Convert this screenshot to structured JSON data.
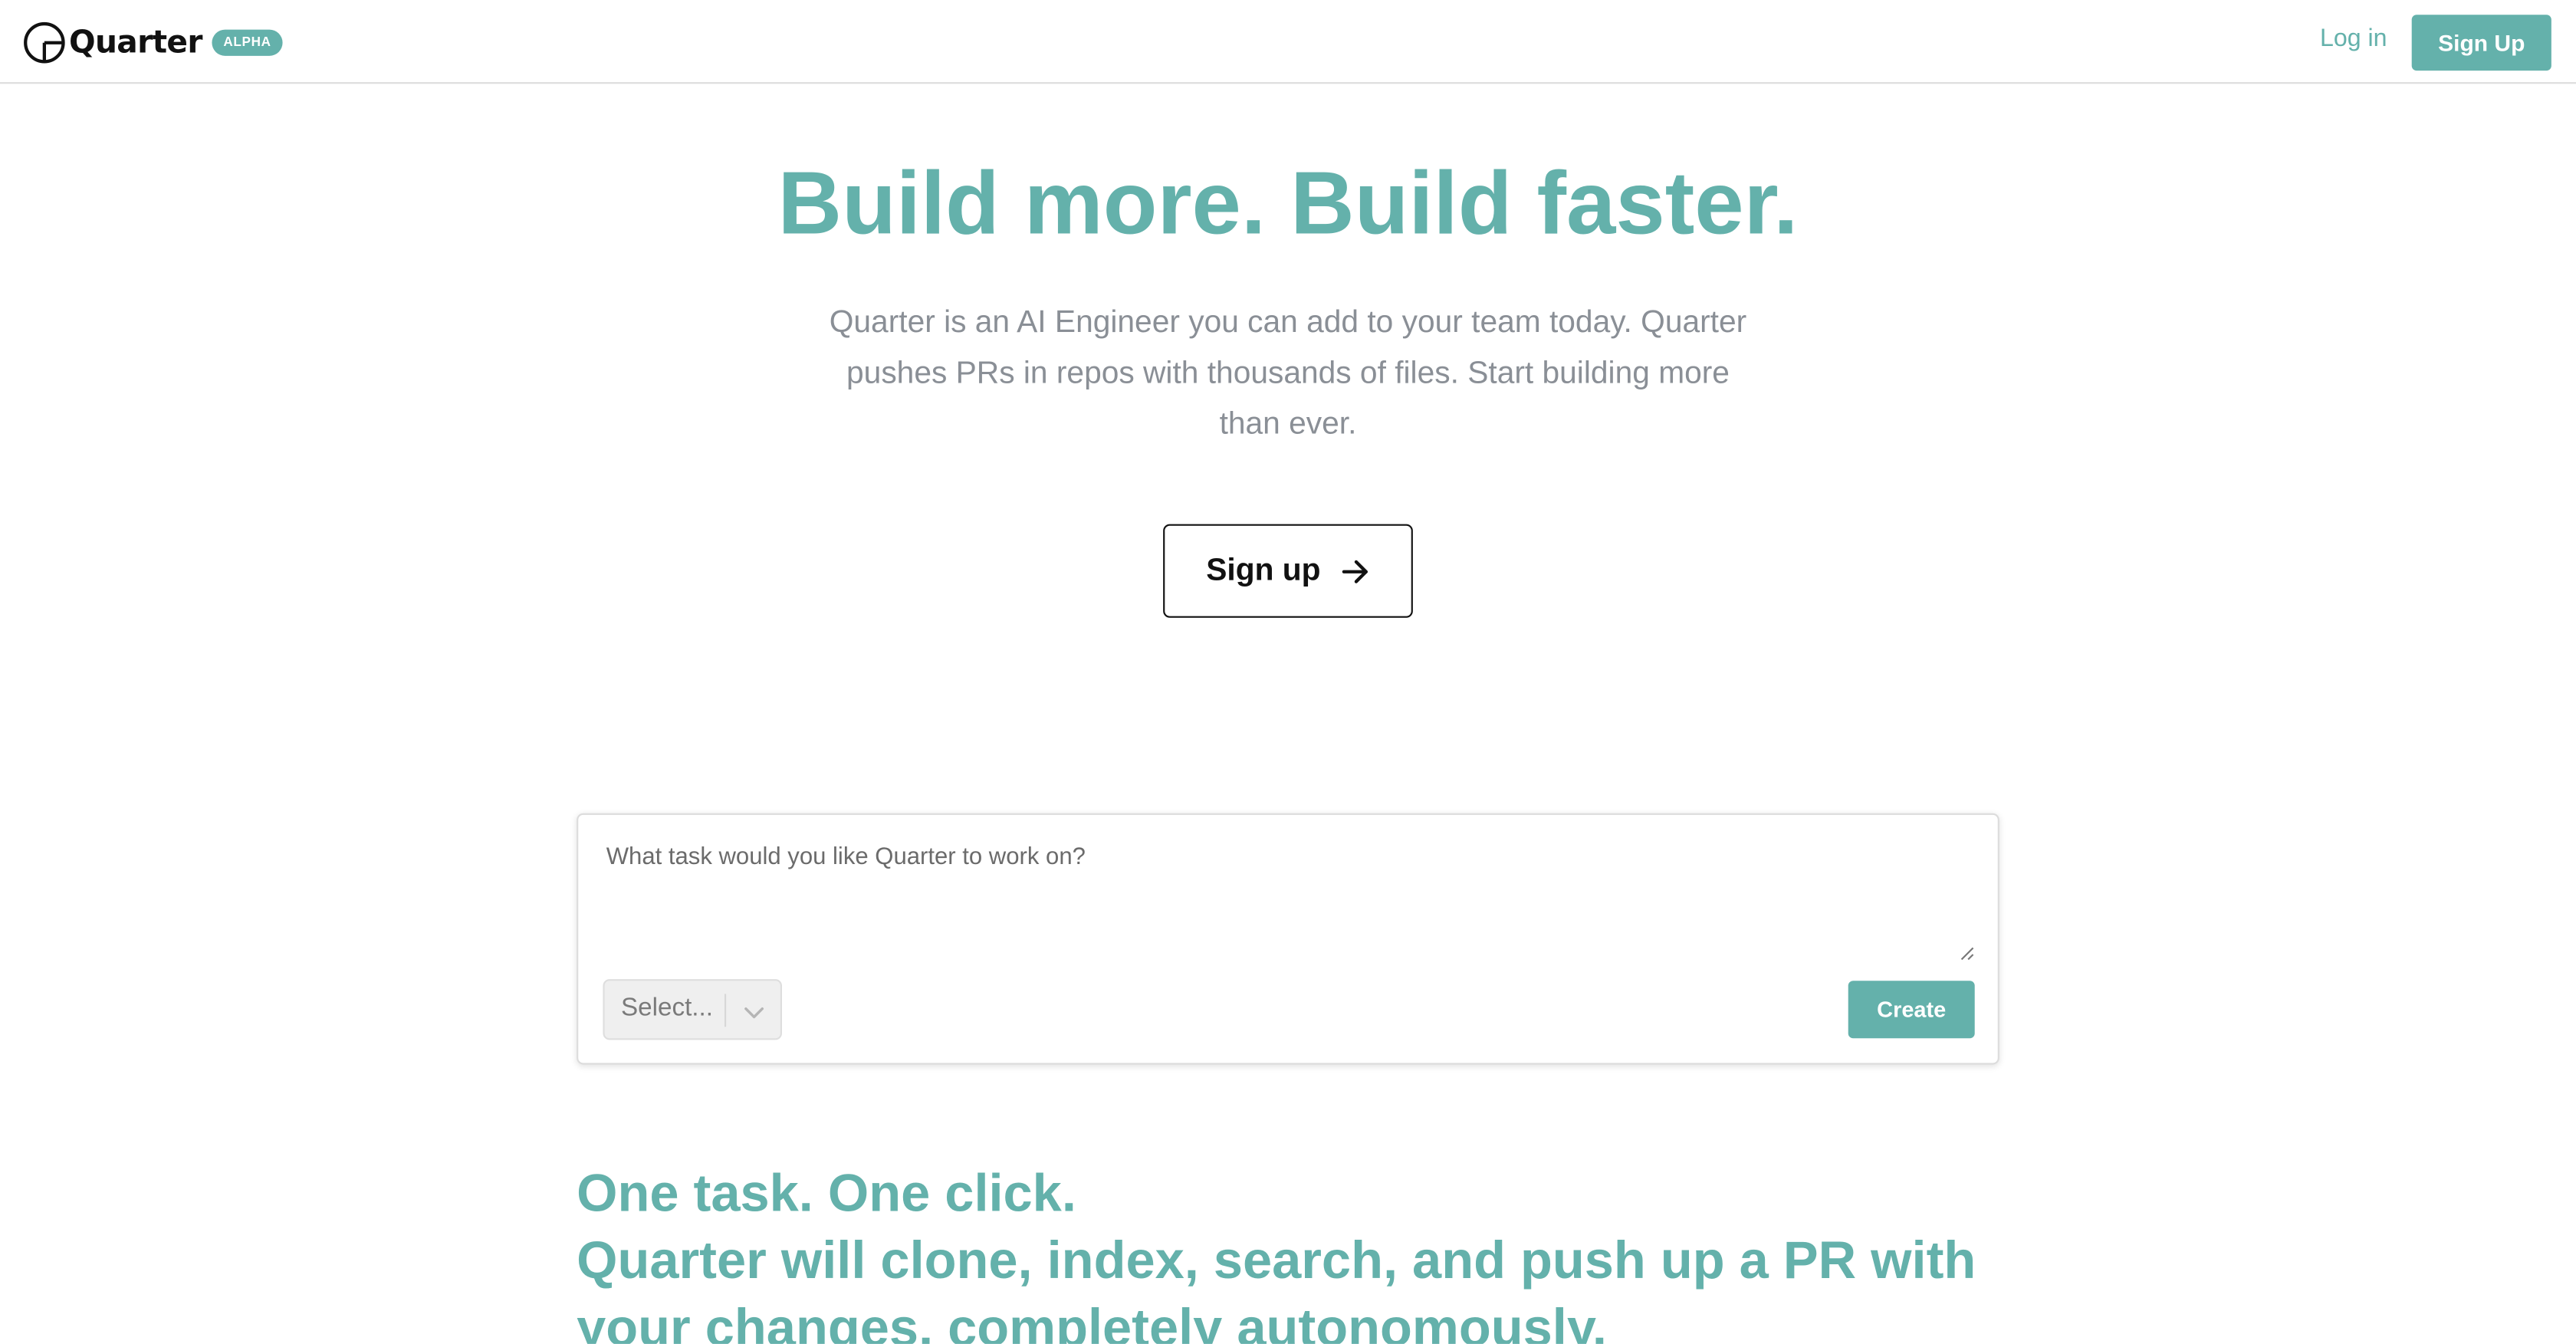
{
  "header": {
    "brand": "Quarter",
    "badge": "ALPHA",
    "login_label": "Log in",
    "signup_label": "Sign Up"
  },
  "hero": {
    "title": "Build more. Build faster.",
    "subtitle": "Quarter is an AI Engineer you can add to your team today. Quarter pushes PRs in repos with thousands of files. Start building more than ever.",
    "cta_label": "Sign up",
    "cta_icon": "arrow-right-icon"
  },
  "task": {
    "placeholder": "What task would you like Quarter to work on?",
    "select_value": "Select...",
    "create_label": "Create"
  },
  "feature": {
    "line1": "One task. One click.",
    "line2": "Quarter will clone, index, search, and push up a PR with",
    "line3": "your changes, completely autonomously."
  },
  "colors": {
    "accent": "#64b1ab",
    "text_dark": "#111111",
    "text_muted": "#8a8f96"
  },
  "icons": {
    "logo": "quarter-circle-logo-icon",
    "select": "chevron-down-icon",
    "textarea": "resize-handle-icon"
  }
}
